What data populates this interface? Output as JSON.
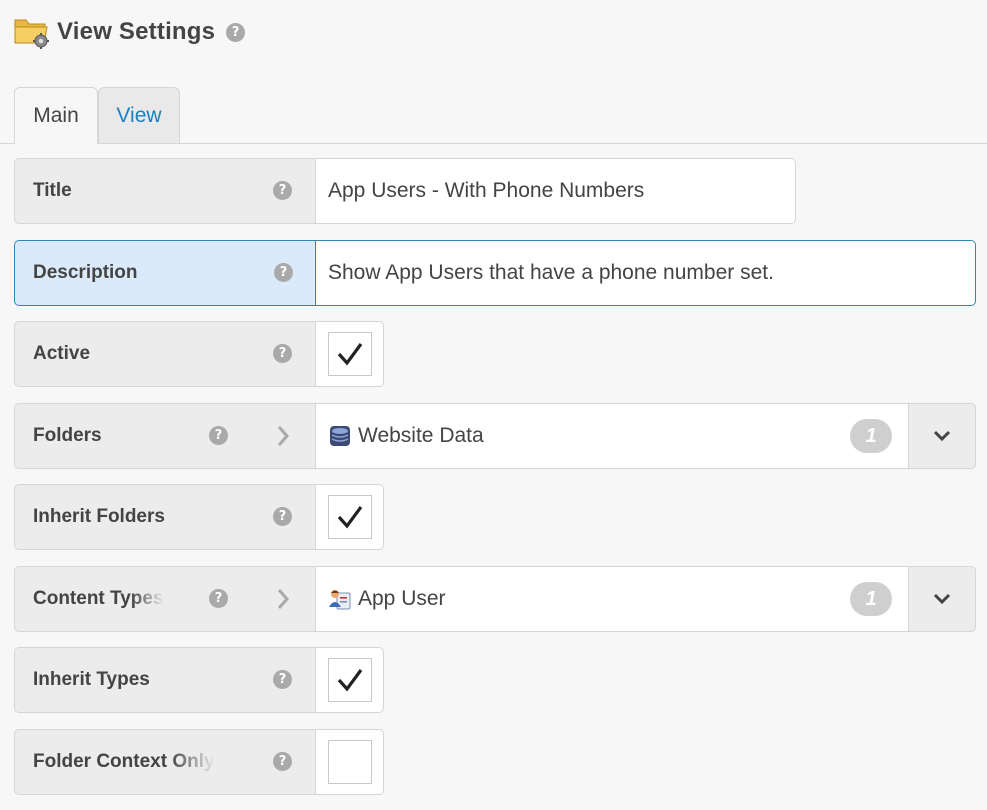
{
  "header": {
    "title": "View Settings",
    "help_glyph": "?"
  },
  "tabs": [
    {
      "label": "Main",
      "active": true
    },
    {
      "label": "View",
      "active": false
    }
  ],
  "fields": {
    "title": {
      "label": "Title",
      "value": "App Users - With Phone Numbers"
    },
    "description": {
      "label": "Description",
      "value": "Show App Users that have a phone number set."
    },
    "active": {
      "label": "Active",
      "checked": true
    },
    "folders": {
      "label": "Folders",
      "selected": "Website Data",
      "count": "1",
      "icon": "database-icon"
    },
    "inherit_folders": {
      "label": "Inherit Folders",
      "checked": true
    },
    "content_types": {
      "label": "Content Types",
      "selected": "App User",
      "count": "1",
      "icon": "app-user-icon"
    },
    "inherit_types": {
      "label": "Inherit Types",
      "checked": true
    },
    "folder_context_only": {
      "label": "Folder Context Only",
      "checked": false
    }
  },
  "colors": {
    "link": "#1b7fc1",
    "focus_border": "#2f86b8",
    "focus_bg": "#dbeafb"
  }
}
